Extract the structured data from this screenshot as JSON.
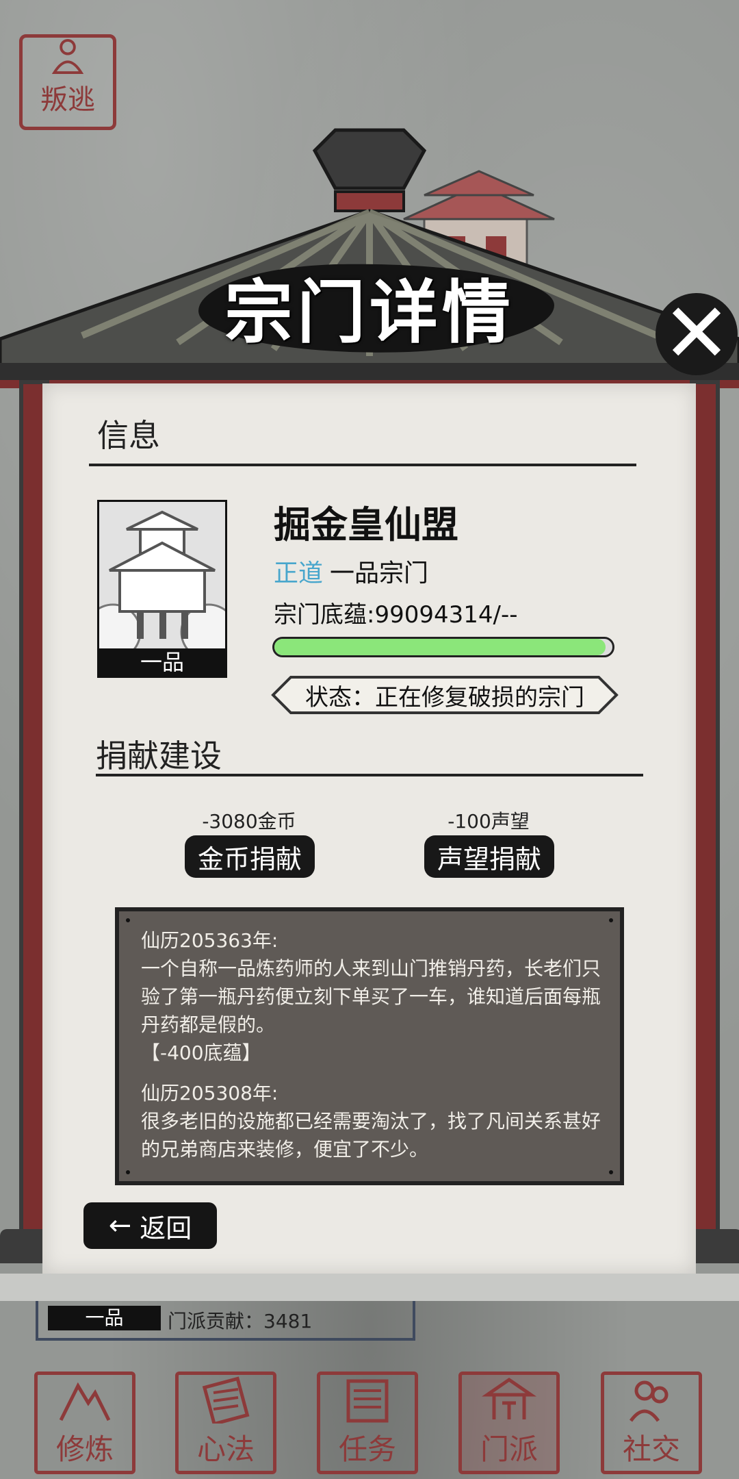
{
  "top_left": {
    "label": "叛逃"
  },
  "header": {
    "title": "宗门详情",
    "close_symbol": "✕"
  },
  "info_section": {
    "title": "信息"
  },
  "sect": {
    "name": "掘金皇仙盟",
    "alignment": "正道",
    "grade_text": "一品宗门",
    "foundation": "宗门底蕴:99094314/--",
    "foundation_progress": 0.98,
    "image_rank": "一品",
    "status": "状态：正在修复破损的宗门"
  },
  "donate_section": {
    "title": "捐献建设",
    "gold": {
      "cost": "-3080金币",
      "label": "金币捐献"
    },
    "fame": {
      "cost": "-100声望",
      "label": "声望捐献"
    }
  },
  "log": [
    {
      "year": "仙历205363年:",
      "text": "一个自称一品炼药师的人来到山门推销丹药，长老们只验了第一瓶丹药便立刻下单买了一车，谁知道后面每瓶丹药都是假的。",
      "effect": "【-400底蕴】"
    },
    {
      "year": "仙历205308年:",
      "text": "很多老旧的设施都已经需要淘汰了，找了凡间关系甚好的兄弟商店来装修，便宜了不少。",
      "effect": ""
    }
  ],
  "back_button": {
    "label": "返回",
    "arrow": "←"
  },
  "bottom_info": {
    "rank": "一品",
    "contribution": "门派贡献：3481"
  },
  "nav": [
    {
      "label": "修炼",
      "active": false
    },
    {
      "label": "心法",
      "active": false
    },
    {
      "label": "任务",
      "active": false
    },
    {
      "label": "门派",
      "active": true
    },
    {
      "label": "社交",
      "active": false
    }
  ],
  "colors": {
    "seal_red": "#8d3a3a",
    "progress_green": "#8be67a",
    "alignment_blue": "#48a6cc"
  }
}
